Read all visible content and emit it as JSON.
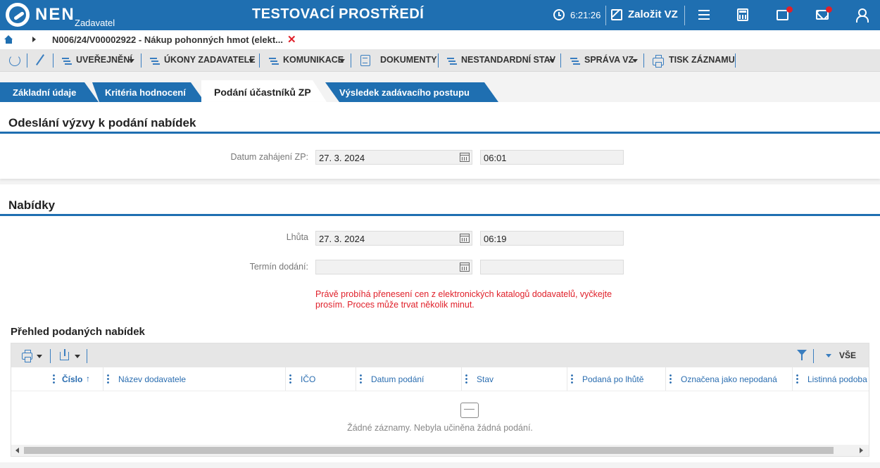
{
  "topbar": {
    "brand": "NEN",
    "brand_sub": "Zadavatel",
    "environment_title": "TESTOVACÍ PROSTŘEDÍ",
    "clock": "6:21:26",
    "create_label": "Založit VZ"
  },
  "breadcrumb": {
    "text": "N006/24/V00002922 - Nákup pohonných hmot (elekt...",
    "close_symbol": "✕"
  },
  "toolbar": {
    "items": [
      {
        "label": "UVEŘEJNĚNÍ"
      },
      {
        "label": "ÚKONY ZADAVATELE"
      },
      {
        "label": "KOMUNIKACE"
      },
      {
        "label": "DOKUMENTY"
      },
      {
        "label": "NESTANDARDNÍ STAV"
      },
      {
        "label": "SPRÁVA VZ"
      },
      {
        "label": "TISK ZÁZNAMU"
      }
    ]
  },
  "tabs": [
    {
      "label": "Základní údaje",
      "active": false
    },
    {
      "label": "Kritéria hodnocení",
      "active": false
    },
    {
      "label": "Podání účastníků ZP",
      "active": true
    },
    {
      "label": "Výsledek zadávacího postupu",
      "active": false
    }
  ],
  "section_invite": {
    "title": "Odeslání výzvy k podání nabídek",
    "start_label": "Datum zahájení ZP:",
    "start_date": "27. 3. 2024",
    "start_time": "06:01"
  },
  "section_offers": {
    "title": "Nabídky",
    "deadline_label": "Lhůta",
    "deadline_date": "27. 3. 2024",
    "deadline_time": "06:19",
    "delivery_label": "Termín dodání:",
    "delivery_date": "",
    "delivery_time": "",
    "warning_line1": "Právě probíhá přenesení cen z elektronických katalogů dodavatelů, vyčkejte",
    "warning_line2": "prosím. Proces může trvat několik minut."
  },
  "grid": {
    "title": "Přehled podaných nabídek",
    "filter_all": "VŠE",
    "columns": [
      "Číslo",
      "Název dodavatele",
      "IČO",
      "Datum podání",
      "Stav",
      "Podaná po lhůtě",
      "Označena jako nepodaná",
      "Listinná podoba"
    ],
    "sort_indicator": "↑",
    "empty_text": "Žádné záznamy. Nebyla učiněna žádná podání."
  }
}
